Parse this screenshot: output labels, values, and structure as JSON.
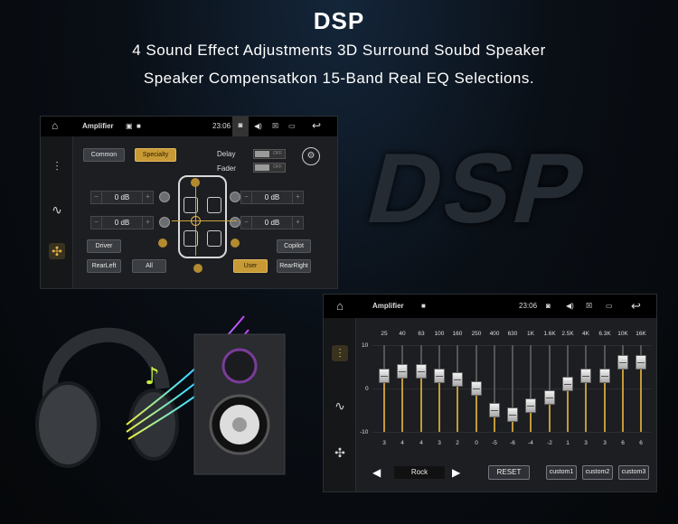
{
  "headline": "DSP",
  "subtitle1": "4 Sound Effect Adjustments 3D Surround Soubd Speaker",
  "subtitle2": "Speaker Compensatkon 15-Band Real EQ Selections.",
  "background_text": "DSP",
  "panel1": {
    "title": "Amplifier",
    "time": "23:06",
    "modes": [
      "Common",
      "Specialty"
    ],
    "delay_label": "Delay",
    "fader_label": "Fader",
    "toggle_off": "OFF",
    "db_values": [
      "0 dB",
      "0 dB",
      "0 dB",
      "0 dB"
    ],
    "buttons": {
      "driver": "Driver",
      "copilot": "Copilot",
      "rearleft": "RearLeft",
      "all": "All",
      "user": "User",
      "rearright": "RearRight"
    }
  },
  "panel2": {
    "title": "Amplifier",
    "time": "23:06",
    "y_labels": [
      "10",
      "0",
      "-10"
    ],
    "frequencies": [
      "25",
      "40",
      "63",
      "100",
      "160",
      "250",
      "400",
      "630",
      "1K",
      "1.6K",
      "2.5K",
      "4K",
      "6.3K",
      "10K",
      "16K"
    ],
    "values": [
      "3",
      "4",
      "4",
      "3",
      "2",
      "0",
      "-5",
      "-6",
      "-4",
      "-2",
      "1",
      "3",
      "3",
      "6",
      "6"
    ],
    "preset": "Rock",
    "reset": "RESET",
    "custom": [
      "custom1",
      "custom2",
      "custom3"
    ]
  },
  "colors": {
    "accent": "#c79a35",
    "panel": "#1c1e22"
  }
}
